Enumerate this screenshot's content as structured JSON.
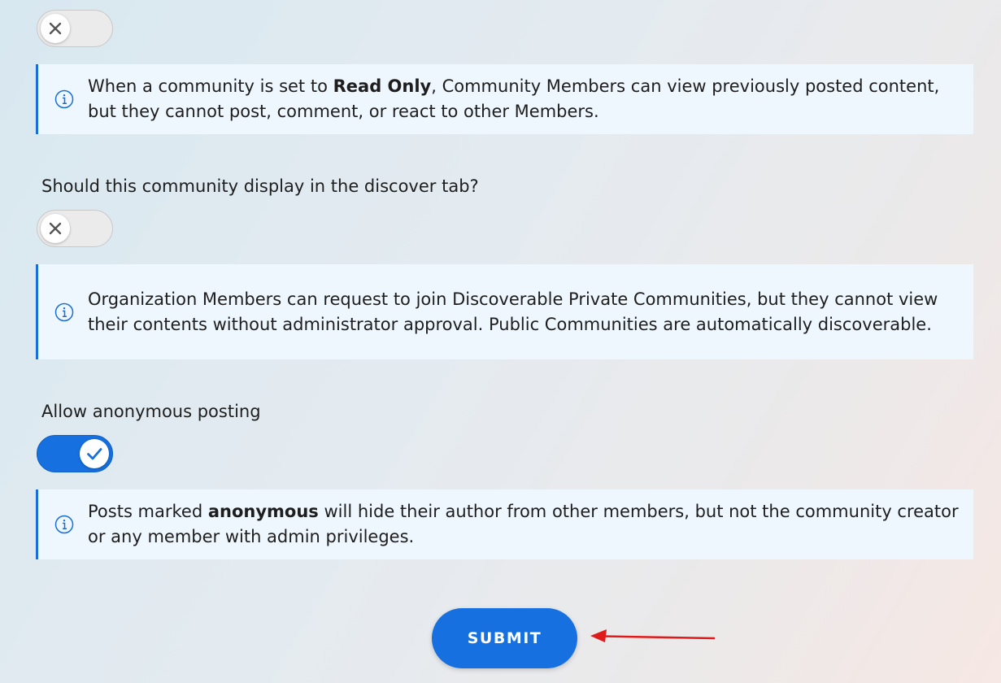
{
  "settings": {
    "read_only": {
      "toggle_state": "off",
      "info_before": "When a community is set to ",
      "info_bold": "Read Only",
      "info_after": ", Community Members can view previously posted content, but they cannot post, comment, or react to other Members."
    },
    "discover": {
      "question": "Should this community display in the discover tab?",
      "toggle_state": "off",
      "info": "Organization Members can request to join Discoverable Private Communities, but they cannot view their contents without administrator approval. Public Communities are automatically discoverable."
    },
    "anonymous": {
      "question": "Allow anonymous posting",
      "toggle_state": "on",
      "info_before": "Posts marked ",
      "info_bold": "anonymous",
      "info_after": " will hide their author from other members, but not the community creator or any member with admin privileges."
    }
  },
  "submit": {
    "label": "SUBMIT"
  },
  "icons": {
    "toggle_off": "x-icon",
    "toggle_on": "check-icon",
    "info": "info-icon",
    "annotation": "red-arrow-icon"
  },
  "colors": {
    "accent": "#1670e0",
    "info_border": "#1a6fd6",
    "info_background": "#eef6fe",
    "annotation_arrow": "#e01b1b"
  }
}
